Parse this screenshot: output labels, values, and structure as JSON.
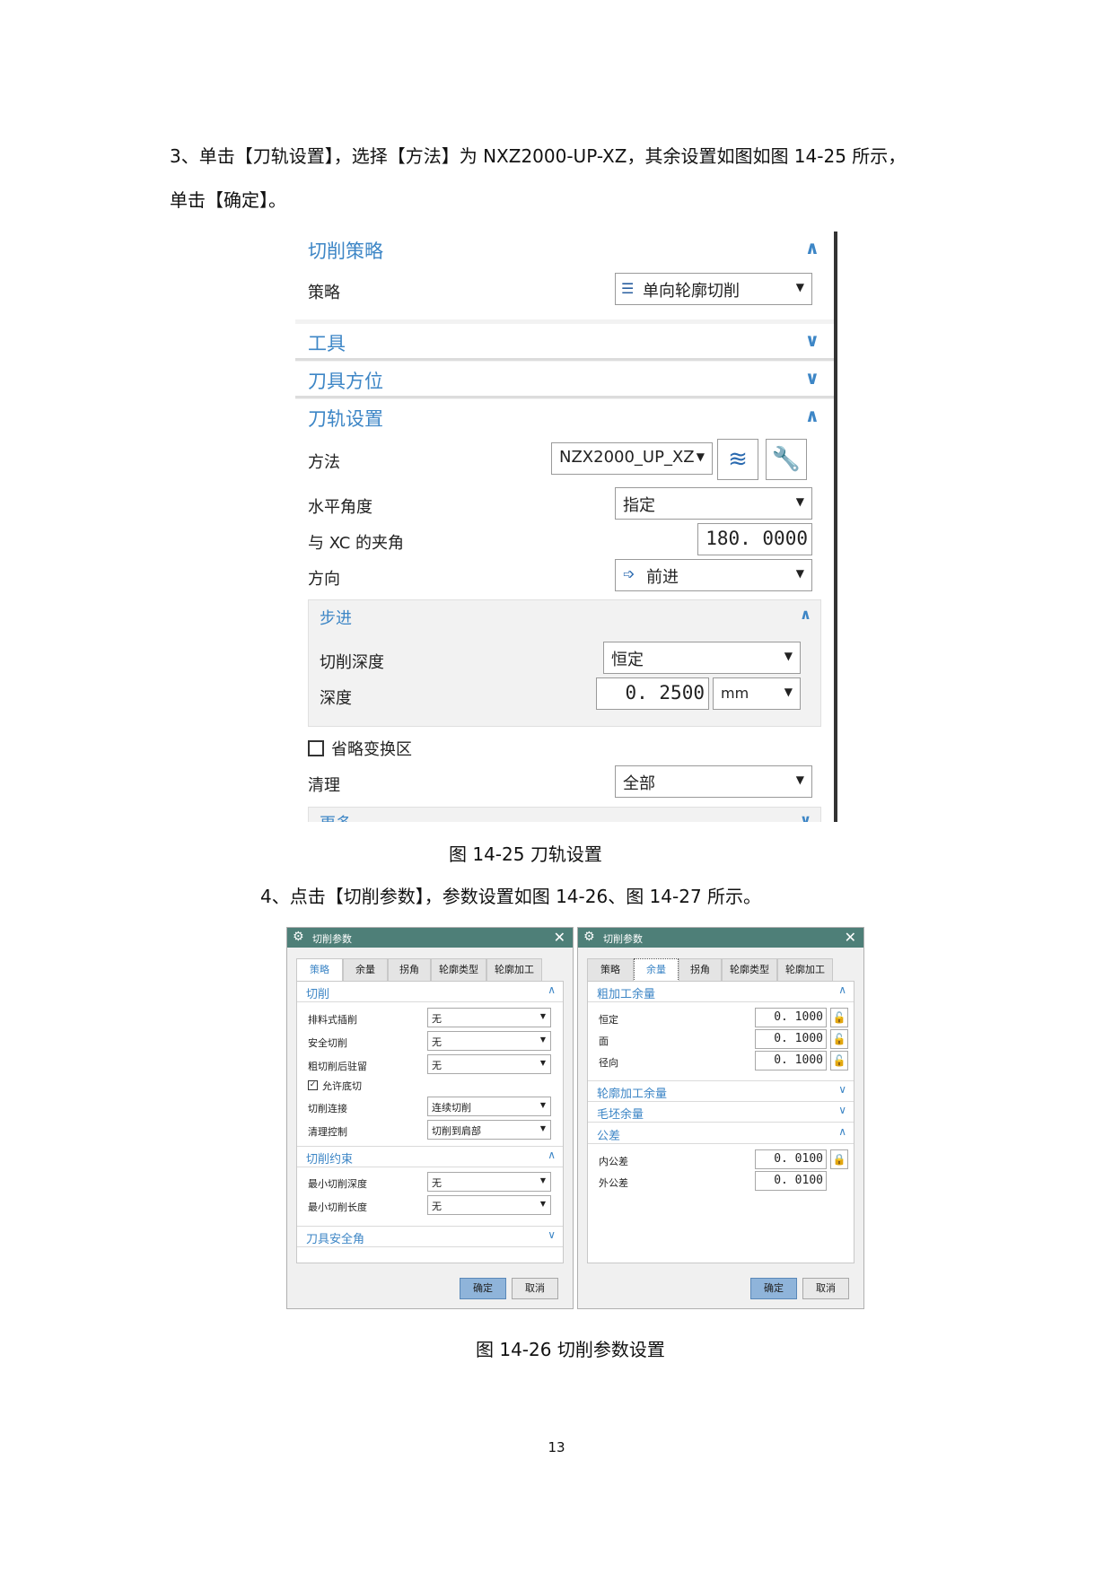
{
  "text": {
    "step3_line1": "3、单击【刀轨设置】，选择【方法】为 NXZ2000-UP-XZ，其余设置如图如图 14-25 所示，",
    "step3_line2": "单击【确定】。",
    "caption_1425": "图 14-25  刀轨设置",
    "step4": "4、点击【切削参数】，参数设置如图 14-26、图 14-27 所示。",
    "caption_1426": "图 14-26  切削参数设置",
    "page_number": "13"
  },
  "fig1": {
    "strategy_section": {
      "title": "切削策略",
      "label": "策略",
      "value": "单向轮廓切削"
    },
    "tool_section": {
      "title": "工具"
    },
    "tool_axis_section": {
      "title": "刀具方位"
    },
    "path_section": {
      "title": "刀轨设置",
      "method_label": "方法",
      "method_value": "NZX2000_UP_XZ",
      "horiz_angle_label": "水平角度",
      "horiz_angle_value": "指定",
      "xc_angle_label": "与 XC 的夹角",
      "xc_angle_value": "180. 0000",
      "direction_label": "方向",
      "direction_value": "前进",
      "stepover": {
        "title": "步进",
        "cut_depth_label": "切削深度",
        "cut_depth_value": "恒定",
        "depth_label": "深度",
        "depth_value": "0. 2500",
        "depth_unit": "mm"
      },
      "omit_label": "省略变换区",
      "cleanup_label": "清理",
      "cleanup_value": "全部",
      "more_title": "更多"
    }
  },
  "dlg1": {
    "title": "切削参数",
    "tabs": [
      "策略",
      "余量",
      "拐角",
      "轮廓类型",
      "轮廓加工"
    ],
    "active_tab": 0,
    "cut": {
      "title": "切削",
      "rows": [
        {
          "label": "排料式插削",
          "value": "无"
        },
        {
          "label": "安全切削",
          "value": "无"
        },
        {
          "label": "粗切削后驻留",
          "value": "无"
        }
      ],
      "allow_undercut": "允许底切",
      "rows2": [
        {
          "label": "切削连接",
          "value": "连续切削"
        },
        {
          "label": "清理控制",
          "value": "切削到肩部"
        }
      ]
    },
    "constraint": {
      "title": "切削约束",
      "rows": [
        {
          "label": "最小切削深度",
          "value": "无"
        },
        {
          "label": "最小切削长度",
          "value": "无"
        }
      ]
    },
    "safety_title": "刀具安全角",
    "ok": "确定",
    "cancel": "取消"
  },
  "dlg2": {
    "title": "切削参数",
    "tabs": [
      "策略",
      "余量",
      "拐角",
      "轮廓类型",
      "轮廓加工"
    ],
    "active_tab": 1,
    "rough": {
      "title": "粗加工余量",
      "rows": [
        {
          "label": "恒定",
          "value": "0. 1000"
        },
        {
          "label": "面",
          "value": "0. 1000"
        },
        {
          "label": "径向",
          "value": "0. 1000"
        }
      ]
    },
    "profile_title": "轮廓加工余量",
    "blank_title": "毛坯余量",
    "tolerance": {
      "title": "公差",
      "rows": [
        {
          "label": "内公差",
          "value": "0. 0100"
        },
        {
          "label": "外公差",
          "value": "0. 0100"
        }
      ]
    },
    "ok": "确定",
    "cancel": "取消"
  }
}
